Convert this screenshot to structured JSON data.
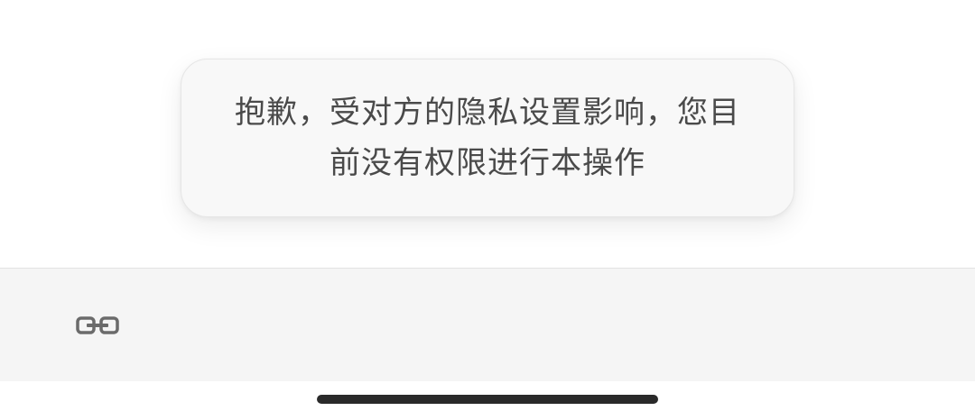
{
  "toast": {
    "message": "抱歉，受对方的隐私设置影响，您目前没有权限进行本操作"
  },
  "bottom_bar": {
    "icons": [
      "link-icon"
    ]
  },
  "system": {
    "home_indicator": "home-indicator"
  },
  "colors": {
    "toast_background": "#f8f8f8",
    "toast_text": "#4a4a4a",
    "bar_background": "#f5f5f5",
    "icon": "#6b6b6b",
    "indicator": "#2a2a2a"
  }
}
